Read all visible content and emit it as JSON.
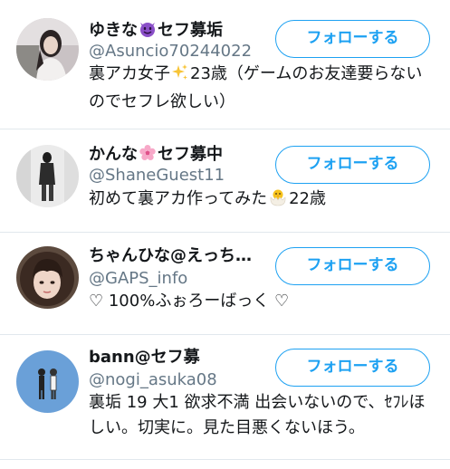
{
  "follow_button_label": "フォローする",
  "users": [
    {
      "name_before": "ゆきな",
      "name_emoji_icon": "smiling-devil-icon",
      "name_after": "セフ募垢",
      "handle": "@Asuncio70244022",
      "bio_before": "裏アカ女子",
      "bio_emoji_icon": "sparkles-icon",
      "bio_after": "23歳（ゲームのお友達要らないのでセフレ欲しい）"
    },
    {
      "name_before": "かんな",
      "name_emoji_icon": "cherry-blossom-icon",
      "name_after": "セフ募中",
      "handle": "@ShaneGuest11",
      "bio_before": "初めて裏アカ作ってみた",
      "bio_emoji_icon": "hatching-chick-icon",
      "bio_after": "22歳"
    },
    {
      "name": "ちゃんひな@えっち…",
      "handle": "@GAPS_info",
      "bio": "♡ 100%ふぉろーばっく ♡"
    },
    {
      "name": "bann@セフ募",
      "handle": "@nogi_asuka08",
      "bio": "裏垢 19 大1 欲求不満 出会いないので、ｾﾌﾚほしい。切実に。見た目悪くないほう。"
    }
  ],
  "colors": {
    "accent": "#1da1f2",
    "handle": "#657786",
    "divider": "#e1e8ed",
    "text": "#14171a"
  }
}
